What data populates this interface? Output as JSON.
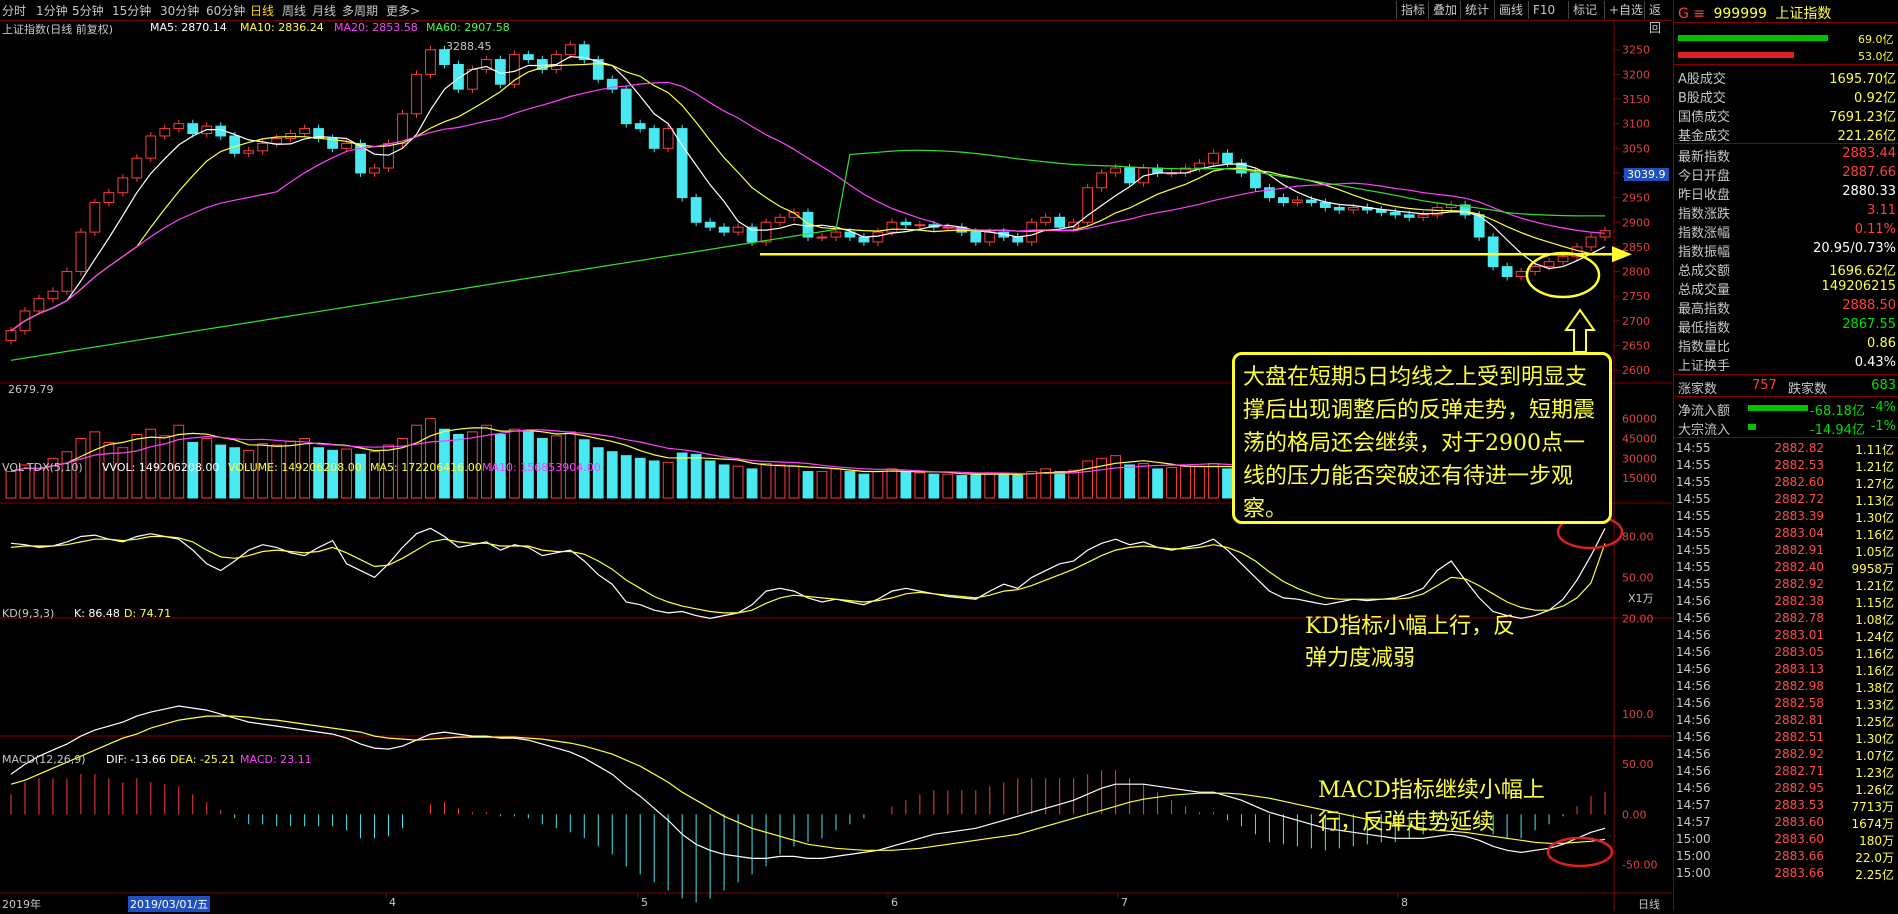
{
  "toolbar": {
    "periods": [
      "分时",
      "1分钟",
      "5分钟",
      "15分钟",
      "30分钟",
      "60分钟",
      "日线",
      "周线",
      "月线",
      "多周期",
      "更多>"
    ],
    "active_period": "日线",
    "right_buttons": [
      "指标",
      "叠加",
      "统计",
      "画线",
      "F10",
      "标记",
      "+自选",
      "返回"
    ]
  },
  "chart_header": {
    "title": "上证指数(日线 前复权)",
    "ma5": "MA5: 2870.14",
    "ma10": "MA10: 2836.24",
    "ma20": "MA20: 2853.58",
    "ma60": "MA60: 2907.58",
    "high_label": "3288.45",
    "low_label": "2679.79",
    "current_price_box": "3039.9"
  },
  "price_axis": [
    "3250",
    "3200",
    "3150",
    "3100",
    "3050",
    "3000",
    "2950",
    "2900",
    "2850",
    "2800",
    "2750",
    "2700",
    "2650",
    "2600"
  ],
  "volume_header": {
    "name": "VOL-TDX(5,10)",
    "vvol": "VVOL: 149206208.00",
    "volume": "VOLUME: 149206208.00",
    "ma5": "MA5: 172206416.00",
    "ma10": "MA10: 156853904.00"
  },
  "volume_axis": [
    "60000",
    "45000",
    "30000",
    "15000"
  ],
  "volume_unit": "X1万",
  "kd_header": {
    "name": "KD(9,3,3)",
    "k": "K: 86.48",
    "d": "D: 74.71"
  },
  "kd_axis": [
    "80.00",
    "50.00",
    "20.00"
  ],
  "macd_header": {
    "name": "MACD(12,26,9)",
    "dif": "DIF: -13.66",
    "dea": "DEA: -25.21",
    "macd": "MACD: 23.11"
  },
  "macd_axis": [
    "100.0",
    "50.00",
    "0.00",
    "-50.00"
  ],
  "date_axis": {
    "year": "2019年",
    "cursor_date": "2019/03/01/五",
    "months": [
      "4",
      "5",
      "6",
      "7",
      "8"
    ],
    "period_tag": "日线"
  },
  "annotations": {
    "callout": "大盘在短期5日均线之上受到明显支撑后出现调整后的反弹走势，短期震荡的格局还会继续，对于2900点一线的压力能否突破还有待进一步观察。",
    "kd_note_line1": "KD指标小幅上行，反",
    "kd_note_line2": "弹力度减弱",
    "macd_note_line1": "MACD指标继续小幅上",
    "macd_note_line2": "行，反弹走势延续"
  },
  "panel": {
    "code_prefix": "G ≡",
    "code": "999999",
    "name": "上证指数",
    "bar1_value": "69.0亿",
    "bar2_value": "53.0亿",
    "rows1": [
      {
        "k": "A股成交",
        "v": "1695.70亿"
      },
      {
        "k": "B股成交",
        "v": "0.92亿"
      },
      {
        "k": "国债成交",
        "v": "7691.23亿"
      },
      {
        "k": "基金成交",
        "v": "221.26亿"
      }
    ],
    "rows2": [
      {
        "k": "最新指数",
        "v": "2883.44"
      },
      {
        "k": "今日开盘",
        "v": "2887.66"
      },
      {
        "k": "昨日收盘",
        "v": "2880.33"
      },
      {
        "k": "指数涨跌",
        "v": "3.11"
      },
      {
        "k": "指数涨幅",
        "v": "0.11%"
      },
      {
        "k": "指数振幅",
        "v": "20.95/0.73%"
      },
      {
        "k": "总成交额",
        "v": "1696.62亿"
      },
      {
        "k": "总成交量",
        "v": "149206215"
      },
      {
        "k": "最高指数",
        "v": "2888.50"
      },
      {
        "k": "最低指数",
        "v": "2867.55"
      },
      {
        "k": "指数量比",
        "v": "0.86"
      },
      {
        "k": "上证换手",
        "v": "0.43%"
      }
    ],
    "up_label": "涨家数",
    "up_count": "757",
    "down_label": "跌家数",
    "down_count": "683",
    "netflow_label": "净流入额",
    "netflow_value": "-68.18亿",
    "netflow_pct": "-4%",
    "block_label": "大宗流入",
    "block_value": "-14.94亿",
    "block_pct": "-1%",
    "ticks": [
      [
        "14:55",
        "2882.82",
        "1.11亿"
      ],
      [
        "14:55",
        "2882.53",
        "1.21亿"
      ],
      [
        "14:55",
        "2882.60",
        "1.27亿"
      ],
      [
        "14:55",
        "2882.72",
        "1.13亿"
      ],
      [
        "14:55",
        "2883.39",
        "1.30亿"
      ],
      [
        "14:55",
        "2883.04",
        "1.16亿"
      ],
      [
        "14:55",
        "2882.91",
        "1.05亿"
      ],
      [
        "14:55",
        "2882.40",
        "9958万"
      ],
      [
        "14:55",
        "2882.92",
        "1.21亿"
      ],
      [
        "14:56",
        "2882.38",
        "1.15亿"
      ],
      [
        "14:56",
        "2882.78",
        "1.08亿"
      ],
      [
        "14:56",
        "2883.01",
        "1.24亿"
      ],
      [
        "14:56",
        "2883.05",
        "1.16亿"
      ],
      [
        "14:56",
        "2883.13",
        "1.16亿"
      ],
      [
        "14:56",
        "2882.98",
        "1.38亿"
      ],
      [
        "14:56",
        "2882.58",
        "1.33亿"
      ],
      [
        "14:56",
        "2882.81",
        "1.25亿"
      ],
      [
        "14:56",
        "2882.51",
        "1.30亿"
      ],
      [
        "14:56",
        "2882.92",
        "1.07亿"
      ],
      [
        "14:56",
        "2882.71",
        "1.23亿"
      ],
      [
        "14:56",
        "2882.95",
        "1.26亿"
      ],
      [
        "14:57",
        "2883.53",
        "7713万"
      ],
      [
        "14:57",
        "2883.60",
        "1674万"
      ],
      [
        "15:00",
        "2883.60",
        "180万"
      ],
      [
        "15:00",
        "2883.66",
        "22.0万"
      ],
      [
        "15:00",
        "2883.66",
        "2.25亿"
      ]
    ]
  },
  "chart_data": {
    "type": "candlestick",
    "indicators": [
      "MA5",
      "MA10",
      "MA20",
      "MA60",
      "VOL-TDX",
      "KD",
      "MACD"
    ],
    "support_level": 2835,
    "closes": [
      2680,
      2720,
      2745,
      2760,
      2800,
      2880,
      2940,
      2960,
      2990,
      3030,
      3075,
      3090,
      3100,
      3080,
      3095,
      3075,
      3040,
      3045,
      3060,
      3070,
      3080,
      3090,
      3070,
      3050,
      3060,
      3000,
      3010,
      3060,
      3120,
      3200,
      3250,
      3220,
      3170,
      3210,
      3230,
      3180,
      3240,
      3230,
      3210,
      3240,
      3260,
      3230,
      3190,
      3170,
      3100,
      3090,
      3050,
      3090,
      2950,
      2900,
      2890,
      2880,
      2890,
      2860,
      2900,
      2910,
      2920,
      2870,
      2870,
      2880,
      2870,
      2860,
      2880,
      2900,
      2895,
      2895,
      2890,
      2890,
      2880,
      2860,
      2880,
      2870,
      2860,
      2900,
      2910,
      2890,
      2900,
      2970,
      3000,
      3010,
      2980,
      3010,
      3000,
      3000,
      3010,
      3020,
      3040,
      3020,
      3000,
      2970,
      2950,
      2940,
      2945,
      2940,
      2930,
      2925,
      2930,
      2925,
      2920,
      2915,
      2910,
      2915,
      2930,
      2935,
      2915,
      2870,
      2810,
      2790,
      2800,
      2810,
      2820,
      2830,
      2850,
      2870,
      2883
    ],
    "volumes": [
      20000,
      25000,
      22000,
      30000,
      35000,
      45000,
      50000,
      42000,
      38000,
      48000,
      52000,
      47000,
      55000,
      42000,
      45000,
      40000,
      38000,
      36000,
      41000,
      40000,
      43000,
      45000,
      38000,
      36000,
      37000,
      33000,
      35000,
      40000,
      45000,
      55000,
      60000,
      52000,
      48000,
      50000,
      55000,
      48000,
      52000,
      50000,
      45000,
      47000,
      50000,
      44000,
      38000,
      35000,
      32000,
      30000,
      28000,
      27000,
      34000,
      33000,
      28000,
      25000,
      24000,
      22000,
      26000,
      25000,
      24000,
      20000,
      20000,
      22000,
      20000,
      18000,
      20000,
      22000,
      20000,
      19000,
      18000,
      18000,
      17000,
      18000,
      19000,
      18000,
      17000,
      20000,
      22000,
      20000,
      21000,
      28000,
      30000,
      32000,
      25000,
      26000,
      22000,
      23000,
      24000,
      24000,
      26000,
      22000,
      20000,
      19000,
      18000,
      17000,
      18000,
      17000,
      17000,
      16000,
      16000,
      16000,
      15000,
      15000,
      15000,
      15000,
      17000,
      18000,
      16000,
      18000,
      22000,
      20000,
      18000,
      16000,
      16000,
      17000,
      18000,
      19000,
      15000
    ],
    "kd_k": [
      75,
      74,
      72,
      73,
      76,
      80,
      81,
      78,
      76,
      80,
      82,
      80,
      78,
      70,
      60,
      55,
      62,
      70,
      74,
      72,
      68,
      66,
      72,
      77,
      60,
      55,
      50,
      60,
      72,
      82,
      86,
      80,
      72,
      74,
      76,
      70,
      74,
      72,
      66,
      68,
      70,
      62,
      52,
      45,
      32,
      30,
      26,
      24,
      25,
      22,
      20,
      22,
      24,
      30,
      40,
      42,
      40,
      35,
      32,
      34,
      32,
      30,
      34,
      40,
      42,
      40,
      38,
      36,
      35,
      34,
      40,
      45,
      42,
      50,
      55,
      60,
      62,
      70,
      75,
      78,
      74,
      76,
      72,
      70,
      72,
      74,
      78,
      70,
      60,
      50,
      40,
      35,
      34,
      32,
      30,
      32,
      34,
      33,
      34,
      35,
      38,
      42,
      55,
      62,
      48,
      35,
      25,
      22,
      20,
      22,
      26,
      34,
      48,
      66,
      86
    ],
    "kd_d": [
      72,
      73,
      73,
      73,
      74,
      76,
      78,
      78,
      77,
      78,
      80,
      80,
      79,
      76,
      70,
      65,
      64,
      66,
      69,
      70,
      69,
      68,
      69,
      72,
      68,
      63,
      58,
      59,
      64,
      70,
      76,
      78,
      76,
      75,
      75,
      73,
      73,
      73,
      70,
      69,
      69,
      67,
      62,
      56,
      48,
      42,
      36,
      32,
      29,
      27,
      25,
      24,
      24,
      26,
      31,
      35,
      37,
      36,
      35,
      34,
      33,
      32,
      33,
      35,
      38,
      39,
      38,
      37,
      36,
      35,
      37,
      40,
      41,
      44,
      48,
      52,
      56,
      61,
      66,
      70,
      72,
      73,
      72,
      71,
      71,
      72,
      74,
      72,
      68,
      62,
      54,
      47,
      42,
      38,
      35,
      34,
      34,
      34,
      34,
      34,
      35,
      38,
      44,
      50,
      49,
      44,
      38,
      32,
      28,
      26,
      26,
      29,
      35,
      46,
      75
    ],
    "macd_dif": [
      40,
      50,
      58,
      64,
      70,
      78,
      84,
      88,
      92,
      98,
      102,
      105,
      108,
      106,
      104,
      100,
      96,
      92,
      90,
      88,
      86,
      84,
      82,
      80,
      76,
      70,
      66,
      65,
      68,
      74,
      80,
      82,
      80,
      78,
      78,
      76,
      76,
      74,
      70,
      66,
      62,
      56,
      48,
      40,
      28,
      18,
      6,
      -6,
      -20,
      -30,
      -36,
      -40,
      -42,
      -44,
      -44,
      -42,
      -42,
      -44,
      -44,
      -42,
      -40,
      -38,
      -36,
      -32,
      -28,
      -24,
      -20,
      -18,
      -16,
      -14,
      -10,
      -6,
      -2,
      2,
      6,
      10,
      14,
      20,
      26,
      30,
      30,
      30,
      28,
      26,
      24,
      22,
      22,
      18,
      14,
      8,
      2,
      -2,
      -6,
      -10,
      -14,
      -16,
      -18,
      -20,
      -22,
      -24,
      -24,
      -24,
      -22,
      -20,
      -22,
      -26,
      -32,
      -36,
      -38,
      -36,
      -34,
      -30,
      -24,
      -18,
      -14
    ],
    "macd_dea": [
      30,
      34,
      40,
      46,
      52,
      58,
      64,
      70,
      76,
      80,
      86,
      90,
      94,
      96,
      98,
      98,
      98,
      97,
      95,
      94,
      92,
      90,
      88,
      86,
      84,
      82,
      78,
      76,
      75,
      74,
      75,
      76,
      77,
      77,
      77,
      77,
      77,
      76,
      75,
      73,
      71,
      68,
      64,
      60,
      54,
      48,
      40,
      32,
      22,
      14,
      6,
      -2,
      -8,
      -14,
      -18,
      -22,
      -26,
      -30,
      -32,
      -34,
      -35,
      -36,
      -36,
      -36,
      -35,
      -34,
      -32,
      -30,
      -28,
      -26,
      -24,
      -22,
      -20,
      -16,
      -12,
      -8,
      -4,
      0,
      4,
      8,
      12,
      15,
      17,
      19,
      20,
      21,
      21,
      21,
      20,
      18,
      16,
      13,
      10,
      7,
      4,
      1,
      -2,
      -5,
      -8,
      -10,
      -12,
      -14,
      -16,
      -17,
      -18,
      -20,
      -22,
      -24,
      -26,
      -28,
      -29,
      -29,
      -28,
      -27,
      -25
    ]
  }
}
